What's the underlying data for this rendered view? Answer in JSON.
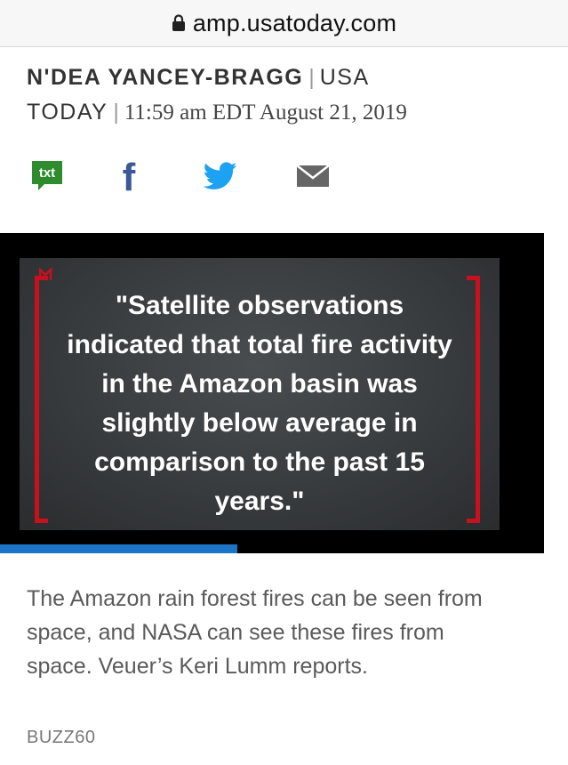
{
  "browser": {
    "url": "amp.usatoday.com"
  },
  "byline": {
    "author": "N'DEA YANCEY-BRAGG",
    "separator": "|",
    "organization_line1": "USA",
    "organization_line2": "TODAY",
    "timestamp": "11:59 am EDT August 21, 2019"
  },
  "share": {
    "items": [
      {
        "icon": "sms-text-icon",
        "label": "txt"
      },
      {
        "icon": "facebook-icon",
        "label": "f"
      },
      {
        "icon": "twitter-icon"
      },
      {
        "icon": "email-icon"
      }
    ]
  },
  "video": {
    "quote_text": "\"Satellite observations indicated that total fire activity in the Amazon basin was slightly below average in comparison to the past 15 years.\"",
    "progress_fraction": 0.436,
    "progress_color": "#1b74c5",
    "bracket_color": "#c8101e"
  },
  "caption": {
    "text": "The Amazon rain forest fires can be seen from space, and NASA can see these fires from space. Veuer’s Keri Lumm reports.",
    "credit": "BUZZ60"
  },
  "colors": {
    "txt_green": "#2e8b2e",
    "facebook_blue": "#3b5998",
    "twitter_blue": "#1da1f2",
    "email_gray": "#666666"
  }
}
